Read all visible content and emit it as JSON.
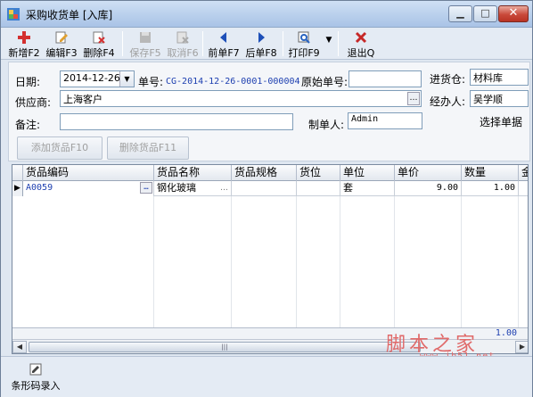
{
  "window": {
    "title": "采购收货单 [入库]"
  },
  "toolbar": {
    "new": "新增F2",
    "edit": "编辑F3",
    "delete": "删除F4",
    "save": "保存F5",
    "cancel": "取消F6",
    "prev": "前单F7",
    "next": "后单F8",
    "print": "打印F9",
    "exit": "退出Q"
  },
  "form": {
    "date_label": "日期:",
    "date_value": "2014-12-26",
    "order_no_label": "单号:",
    "order_no_value": "CG-2014-12-26-0001-000004",
    "orig_no_label": "原始单号:",
    "orig_no_value": "",
    "warehouse_label": "进货仓:",
    "warehouse_value": "材料库",
    "supplier_label": "供应商:",
    "supplier_value": "上海客户",
    "handler_label": "经办人:",
    "handler_value": "吴学顺",
    "remark_label": "备注:",
    "remark_value": "",
    "creator_label": "制单人:",
    "creator_value": "Admin",
    "select_order_label": "选择单据",
    "add_goods_button": "添加货品F10",
    "delete_goods_button": "删除货品F11"
  },
  "grid": {
    "columns": [
      "货品编码",
      "货品名称",
      "货品规格",
      "货位",
      "单位",
      "单价",
      "数量",
      "金"
    ],
    "rows": [
      {
        "code": "A0059",
        "name": "钢化玻璃",
        "spec": "",
        "location": "",
        "unit": "套",
        "price": "9.00",
        "qty": "1.00"
      }
    ],
    "footer_qty": "1.00"
  },
  "bottom": {
    "barcode_entry": "条形码录入"
  },
  "watermark": {
    "text": "脚本之家",
    "url": "www.jb51.net"
  },
  "icons": [
    "new-icon",
    "edit-icon",
    "delete-icon",
    "save-icon",
    "cancel-icon",
    "prev-icon",
    "next-icon",
    "print-icon",
    "exit-icon",
    "barcode-icon"
  ]
}
